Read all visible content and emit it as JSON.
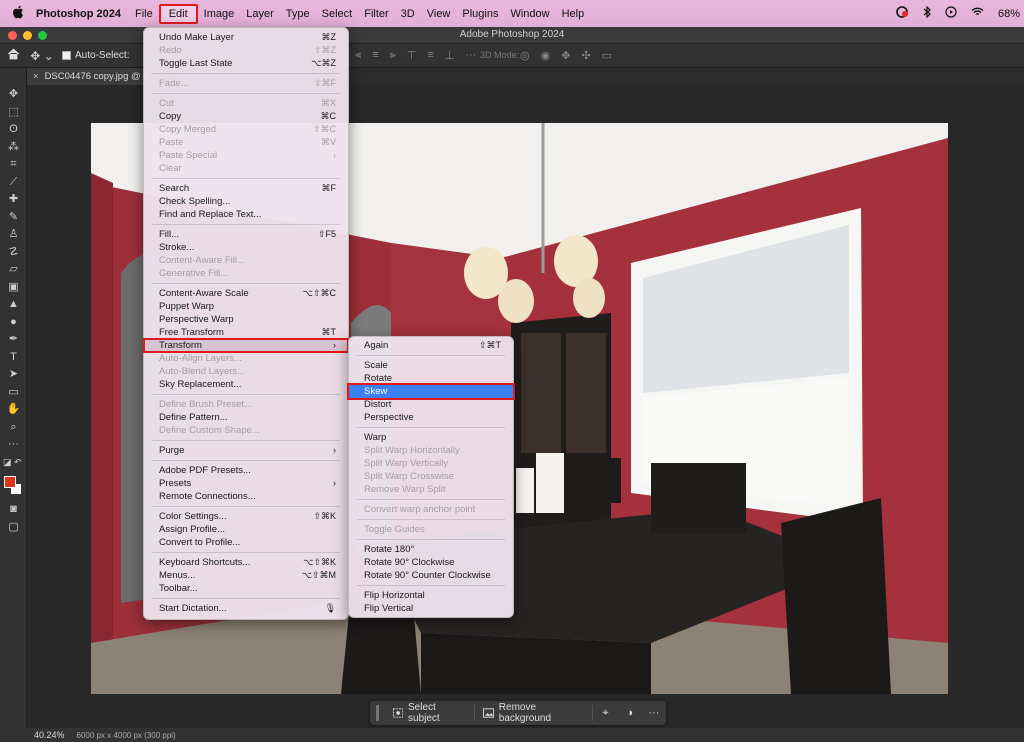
{
  "menubar": {
    "app_name": "Photoshop 2024",
    "items": [
      "File",
      "Edit",
      "Image",
      "Layer",
      "Type",
      "Select",
      "Filter",
      "3D",
      "View",
      "Plugins",
      "Window",
      "Help"
    ],
    "battery": "68%"
  },
  "titlebar": {
    "title": "Adobe Photoshop 2024"
  },
  "options": {
    "auto_select": "Auto-Select:",
    "mode3d": "3D Mode:"
  },
  "doc_tab": {
    "label": "DSC04476 copy.jpg @ 4"
  },
  "edit_menu": {
    "groups": [
      [
        {
          "label": "Undo Make Layer",
          "shortcut": "⌘Z",
          "disabled": false
        },
        {
          "label": "Redo",
          "shortcut": "⇧⌘Z",
          "disabled": true
        },
        {
          "label": "Toggle Last State",
          "shortcut": "⌥⌘Z",
          "disabled": false
        }
      ],
      [
        {
          "label": "Fade...",
          "shortcut": "⇧⌘F",
          "disabled": true
        }
      ],
      [
        {
          "label": "Cut",
          "shortcut": "⌘X",
          "disabled": true
        },
        {
          "label": "Copy",
          "shortcut": "⌘C",
          "disabled": false
        },
        {
          "label": "Copy Merged",
          "shortcut": "⇧⌘C",
          "disabled": true
        },
        {
          "label": "Paste",
          "shortcut": "⌘V",
          "disabled": true
        },
        {
          "label": "Paste Special",
          "shortcut": "",
          "arrow": true,
          "disabled": true
        },
        {
          "label": "Clear",
          "shortcut": "",
          "disabled": true
        }
      ],
      [
        {
          "label": "Search",
          "shortcut": "⌘F",
          "disabled": false
        },
        {
          "label": "Check Spelling...",
          "shortcut": "",
          "disabled": false
        },
        {
          "label": "Find and Replace Text...",
          "shortcut": "",
          "disabled": false
        }
      ],
      [
        {
          "label": "Fill...",
          "shortcut": "⇧F5",
          "disabled": false
        },
        {
          "label": "Stroke...",
          "shortcut": "",
          "disabled": false
        },
        {
          "label": "Content-Aware Fill...",
          "shortcut": "",
          "disabled": true
        },
        {
          "label": "Generative Fill...",
          "shortcut": "",
          "disabled": true
        }
      ],
      [
        {
          "label": "Content-Aware Scale",
          "shortcut": "⌥⇧⌘C",
          "disabled": false
        },
        {
          "label": "Puppet Warp",
          "shortcut": "",
          "disabled": false
        },
        {
          "label": "Perspective Warp",
          "shortcut": "",
          "disabled": false
        },
        {
          "label": "Free Transform",
          "shortcut": "⌘T",
          "disabled": false
        },
        {
          "label": "Transform",
          "shortcut": "",
          "arrow": true,
          "disabled": false,
          "active": true
        },
        {
          "label": "Auto-Align Layers...",
          "shortcut": "",
          "disabled": true
        },
        {
          "label": "Auto-Blend Layers...",
          "shortcut": "",
          "disabled": true
        },
        {
          "label": "Sky Replacement...",
          "shortcut": "",
          "disabled": false
        }
      ],
      [
        {
          "label": "Define Brush Preset...",
          "shortcut": "",
          "disabled": true
        },
        {
          "label": "Define Pattern...",
          "shortcut": "",
          "disabled": false
        },
        {
          "label": "Define Custom Shape...",
          "shortcut": "",
          "disabled": true
        }
      ],
      [
        {
          "label": "Purge",
          "shortcut": "",
          "arrow": true,
          "disabled": false
        }
      ],
      [
        {
          "label": "Adobe PDF Presets...",
          "shortcut": "",
          "disabled": false
        },
        {
          "label": "Presets",
          "shortcut": "",
          "arrow": true,
          "disabled": false
        },
        {
          "label": "Remote Connections...",
          "shortcut": "",
          "disabled": false
        }
      ],
      [
        {
          "label": "Color Settings...",
          "shortcut": "⇧⌘K",
          "disabled": false
        },
        {
          "label": "Assign Profile...",
          "shortcut": "",
          "disabled": false
        },
        {
          "label": "Convert to Profile...",
          "shortcut": "",
          "disabled": false
        }
      ],
      [
        {
          "label": "Keyboard Shortcuts...",
          "shortcut": "⌥⇧⌘K",
          "disabled": false
        },
        {
          "label": "Menus...",
          "shortcut": "⌥⇧⌘M",
          "disabled": false
        },
        {
          "label": "Toolbar...",
          "shortcut": "",
          "disabled": false
        }
      ],
      [
        {
          "label": "Start Dictation...",
          "shortcut": "🎙",
          "disabled": false
        }
      ]
    ]
  },
  "transform_menu": {
    "groups": [
      [
        {
          "label": "Again",
          "shortcut": "⇧⌘T",
          "disabled": false
        }
      ],
      [
        {
          "label": "Scale",
          "shortcut": "",
          "disabled": false
        },
        {
          "label": "Rotate",
          "shortcut": "",
          "disabled": false
        },
        {
          "label": "Skew",
          "shortcut": "",
          "disabled": false,
          "selected": true
        },
        {
          "label": "Distort",
          "shortcut": "",
          "disabled": false
        },
        {
          "label": "Perspective",
          "shortcut": "",
          "disabled": false
        }
      ],
      [
        {
          "label": "Warp",
          "shortcut": "",
          "disabled": false
        },
        {
          "label": "Split Warp Horizontally",
          "shortcut": "",
          "disabled": true
        },
        {
          "label": "Split Warp Vertically",
          "shortcut": "",
          "disabled": true
        },
        {
          "label": "Split Warp Crosswise",
          "shortcut": "",
          "disabled": true
        },
        {
          "label": "Remove Warp Split",
          "shortcut": "",
          "disabled": true
        }
      ],
      [
        {
          "label": "Convert warp anchor point",
          "shortcut": "",
          "disabled": true
        }
      ],
      [
        {
          "label": "Toggle Guides",
          "shortcut": "",
          "disabled": true
        }
      ],
      [
        {
          "label": "Rotate 180°",
          "shortcut": "",
          "disabled": false
        },
        {
          "label": "Rotate 90° Clockwise",
          "shortcut": "",
          "disabled": false
        },
        {
          "label": "Rotate 90° Counter Clockwise",
          "shortcut": "",
          "disabled": false
        }
      ],
      [
        {
          "label": "Flip Horizontal",
          "shortcut": "",
          "disabled": false
        },
        {
          "label": "Flip Vertical",
          "shortcut": "",
          "disabled": false
        }
      ]
    ]
  },
  "taskbar": {
    "select_subject": "Select subject",
    "remove_background": "Remove background"
  },
  "status": {
    "zoom": "40.24%",
    "dims": "6000 px x 4000 px (300 ppi)"
  },
  "colors": {
    "foreground": "#e0301e",
    "background": "#ffffff",
    "highlight": "#3b82f0",
    "annotation": "#e0191f"
  }
}
